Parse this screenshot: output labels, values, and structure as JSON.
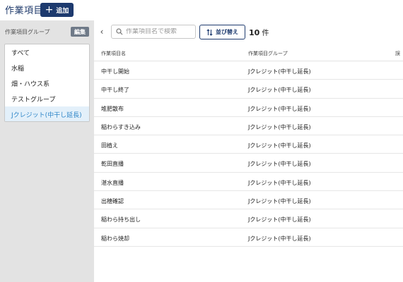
{
  "header": {
    "title": "作業項目",
    "add_label": "追加"
  },
  "sidebar": {
    "heading": "作業項目グループ",
    "edit_label": "編集",
    "groups": [
      {
        "label": "すべて"
      },
      {
        "label": "水稲"
      },
      {
        "label": "畑・ハウス系"
      },
      {
        "label": "テストグループ"
      },
      {
        "label": "Jクレジット(中干し延長)"
      }
    ],
    "selected_index": 4,
    "selected_color": "#2f86c8"
  },
  "toolbar": {
    "collapse_symbol": "‹",
    "search_placeholder": "作業項目名で検索",
    "sort_label": "並び替え",
    "count_value": "10",
    "count_unit": "件"
  },
  "table": {
    "columns": [
      "作業項目名",
      "作業項目グループ",
      "誤"
    ],
    "rows": [
      {
        "name": "中干し開始",
        "group": "Jクレジット(中干し延長)"
      },
      {
        "name": "中干し終了",
        "group": "Jクレジット(中干し延長)"
      },
      {
        "name": "堆肥散布",
        "group": "Jクレジット(中干し延長)"
      },
      {
        "name": "稲わらすき込み",
        "group": "Jクレジット(中干し延長)"
      },
      {
        "name": "田植え",
        "group": "Jクレジット(中干し延長)"
      },
      {
        "name": "乾田直播",
        "group": "Jクレジット(中干し延長)"
      },
      {
        "name": "湛水直播",
        "group": "Jクレジット(中干し延長)"
      },
      {
        "name": "出穂確認",
        "group": "Jクレジット(中干し延長)"
      },
      {
        "name": "稲わら持ち出し",
        "group": "Jクレジット(中干し延長)"
      },
      {
        "name": "稲わら焼却",
        "group": "Jクレジット(中干し延長)"
      }
    ]
  },
  "colors": {
    "primary": "#1d3a6e",
    "title": "#1f3a6b",
    "panel_bg": "#e3e3e3"
  }
}
